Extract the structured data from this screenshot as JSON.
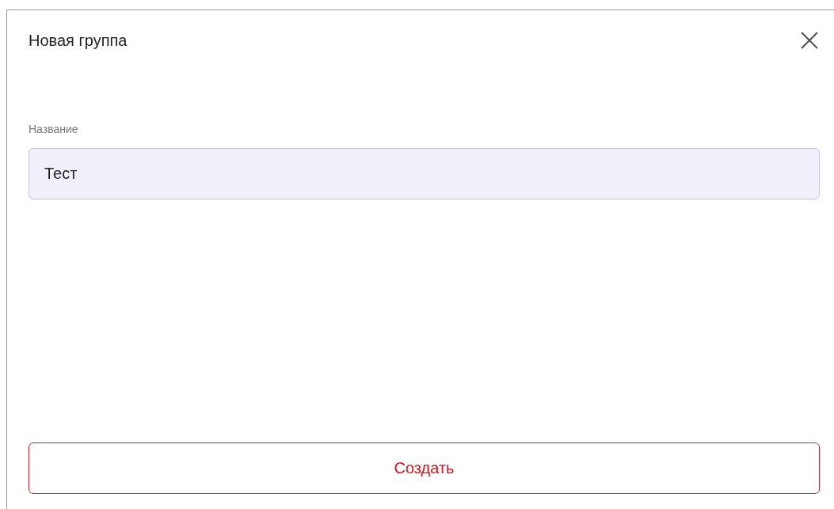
{
  "dialog": {
    "title": "Новая группа"
  },
  "field": {
    "label": "Название",
    "value": "Тест"
  },
  "button": {
    "label": "Создать"
  }
}
